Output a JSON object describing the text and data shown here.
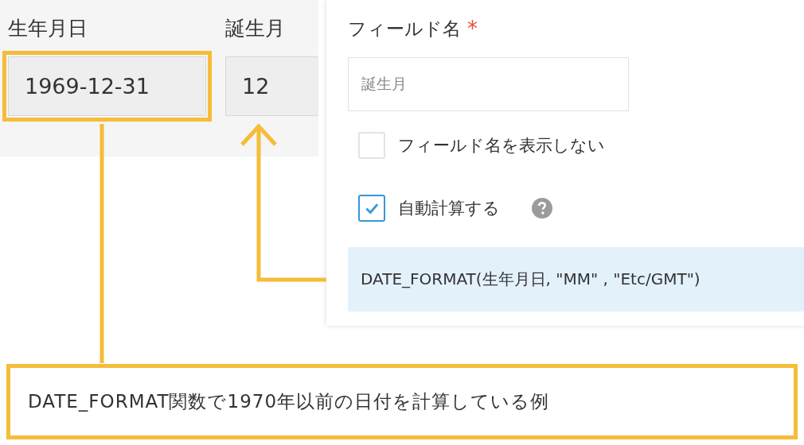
{
  "source_fields": [
    {
      "label": "生年月日",
      "value": "1969-12-31",
      "highlighted": true
    },
    {
      "label": "誕生月",
      "value": "12",
      "highlighted": false
    }
  ],
  "settings": {
    "field_name_label": "フィールド名",
    "required_mark": "*",
    "field_name_value": "誕生月",
    "options": [
      {
        "label": "フィールド名を表示しない",
        "checked": false,
        "help": false
      },
      {
        "label": "自動計算する",
        "checked": true,
        "help": true
      }
    ],
    "formula": "DATE_FORMAT(生年月日, \"MM\" , \"Etc/GMT\")"
  },
  "caption": "DATE_FORMAT関数で1970年以前の日付を計算している例"
}
